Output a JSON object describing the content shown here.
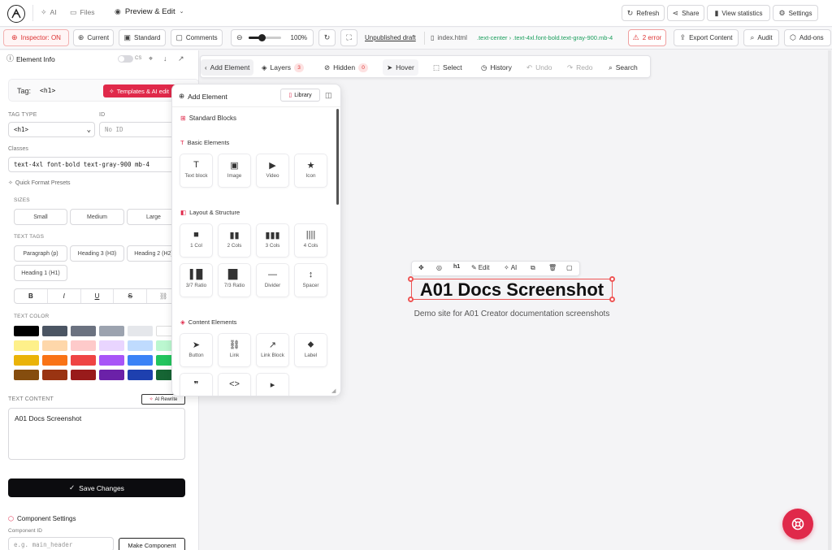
{
  "topbar": {
    "tab_ai": "AI",
    "tab_files": "Files",
    "mode": "Preview & Edit",
    "refresh": "Refresh",
    "share": "Share",
    "view_statistics": "View statistics",
    "settings": "Settings"
  },
  "toolbar": {
    "inspector": "Inspector: ON",
    "current": "Current",
    "standard": "Standard",
    "comments": "Comments",
    "zoom": "100%",
    "unpublished": "Unpublished draft",
    "file": "index.html",
    "breadcrumb": ".text-center › .text-4xl.font-bold.text-gray-900.mb-4",
    "errors": "2 error",
    "export": "Export Content",
    "audit": "Audit",
    "addons": "Add-ons"
  },
  "left": {
    "title": "Element Info",
    "css_toggle": "CS",
    "tag_label": "Tag:",
    "tag_value": "<h1>",
    "templates_btn": "Templates & AI edit",
    "tag_type_label": "TAG TYPE",
    "tag_type_value": "<h1>",
    "id_label": "ID",
    "id_placeholder": "No ID",
    "classes_label": "Classes",
    "classes_value": "text-4xl font-bold text-gray-900 mb-4",
    "presets_label": "Quick Format Presets",
    "sizes_label": "SIZES",
    "sizes": [
      "Small",
      "Medium",
      "Large"
    ],
    "text_tags_label": "TEXT TAGS",
    "text_tags": [
      "Paragraph (p)",
      "Heading 3 (H3)",
      "Heading 2 (H2)",
      "Heading 1 (H1)"
    ],
    "format_buttons": [
      "B",
      "I",
      "U",
      "S"
    ],
    "text_color_label": "TEXT COLOR",
    "colors": [
      [
        "#000000",
        "#4b5563",
        "#6b7280",
        "#9ca3af",
        "#e5e7eb",
        "#ffffff"
      ],
      [
        "#fef08a",
        "#fed7aa",
        "#fecaca",
        "#e9d5ff",
        "#bfdbfe",
        "#bbf7d0"
      ],
      [
        "#eab308",
        "#f97316",
        "#ef4444",
        "#a855f7",
        "#3b82f6",
        "#22c55e"
      ],
      [
        "#854d0e",
        "#9a3412",
        "#991b1b",
        "#6b21a8",
        "#1e40af",
        "#166534"
      ]
    ],
    "text_content_label": "TEXT CONTENT",
    "ai_rewrite": "AI Rewrite",
    "text_content_value": "A01 Docs Screenshot",
    "save": "Save Changes",
    "component_settings": "Component Settings",
    "component_id_label": "Component ID",
    "component_id_placeholder": "e.g. main_header",
    "make_component": "Make Component"
  },
  "canvas_toolbar": {
    "add_element": "Add Element",
    "layers": "Layers",
    "layers_count": "3",
    "hidden": "Hidden",
    "hidden_count": "0",
    "hover": "Hover",
    "select": "Select",
    "history": "History",
    "undo": "Undo",
    "redo": "Redo",
    "search": "Search"
  },
  "add_panel": {
    "title": "Add Element",
    "library": "Library",
    "standard_blocks": "Standard Blocks",
    "basic_elements": "Basic Elements",
    "basic": [
      "Text block",
      "Image",
      "Video",
      "Icon"
    ],
    "layout_structure": "Layout & Structure",
    "layout": [
      "1 Col",
      "2 Cols",
      "3 Cols",
      "4 Cols",
      "3/7 Ratio",
      "7/3 Ratio",
      "Divider",
      "Spacer"
    ],
    "content_elements": "Content Elements",
    "content": [
      "Button",
      "Link",
      "Link Block",
      "Label"
    ]
  },
  "canvas": {
    "heading": "A01 Docs Screenshot",
    "subtitle": "Demo site for A01 Creator documentation screenshots",
    "element_toolbar": {
      "tag": "h1",
      "edit": "Edit",
      "ai": "AI"
    }
  },
  "colors": {
    "accent_red": "#e0294a",
    "dark": "#0c0c0f"
  }
}
